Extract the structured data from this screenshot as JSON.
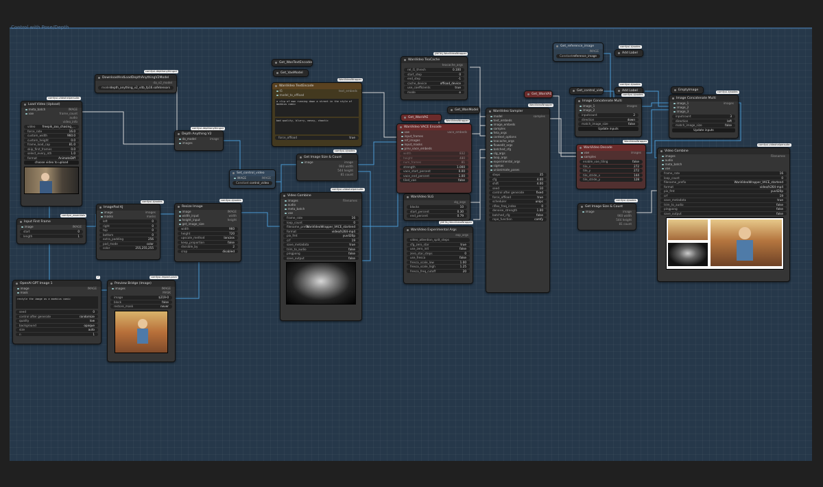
{
  "group": {
    "title": "Control with Pose/Depth"
  },
  "nodes": {
    "load_video": {
      "title": "Load Video (Upload)",
      "badge": "comfyui-videohelpersuite",
      "outputs": [
        "IMAGE",
        "frame_count",
        "audio",
        "video_info"
      ],
      "inputs": [
        "meta_batch",
        "vae"
      ],
      "widgets": [
        [
          "video",
          "freepik_zoo_chasing_..."
        ],
        [
          "force_rate",
          "16.0"
        ],
        [
          "custom_width",
          "960.0"
        ],
        [
          "custom_height",
          "0.0"
        ],
        [
          "frame_load_cap",
          "81.0"
        ],
        [
          "skip_first_frames",
          "0.0"
        ],
        [
          "select_every_nth",
          "1.0"
        ],
        [
          "format",
          "AnimateDiff"
        ]
      ],
      "button": "choose video to upload"
    },
    "download_depth": {
      "title": "DownloadAndLoadDepthAnythingV2Model",
      "badge": "comfyui-depthanythingv2",
      "output": "da_v2_model",
      "widgets": [
        [
          "model",
          "depth_anything_v2_vitb_fp16.safetensors"
        ]
      ]
    },
    "depth_anything": {
      "title": "Depth Anything V2",
      "badge": "comfyui-depthanythingv2",
      "inputs": [
        "da_model",
        "images"
      ],
      "output": "image"
    },
    "set_control": {
      "title": "Set_control_video",
      "in": "IMAGE",
      "out": "IMAGE",
      "widget_label": "Constant",
      "widget_value": "control_video"
    },
    "input_first_frame": {
      "title": "Input First Frame",
      "badge": "comfyui_essentials",
      "input": "image",
      "output": "IMAGE",
      "widgets": [
        [
          "start",
          "0"
        ],
        [
          "length",
          "1"
        ]
      ]
    },
    "image_pad": {
      "title": "ImagePad KJ",
      "badge": "comfyui-kjnodes",
      "inputs": [
        "image",
        "masks"
      ],
      "outputs": [
        "images",
        "masks"
      ],
      "widgets": [
        [
          "left",
          "0"
        ],
        [
          "right",
          "0"
        ],
        [
          "top",
          "0"
        ],
        [
          "bottom",
          "0"
        ],
        [
          "extra_padding",
          "256"
        ],
        [
          "pad_mode",
          "color"
        ],
        [
          "color",
          "255,255,255"
        ]
      ]
    },
    "resize_image": {
      "title": "Resize Image",
      "badge": "comfyui-kjnodes",
      "inputs": [
        "image",
        "width_input",
        "height_input",
        "get_image_size"
      ],
      "outputs": [
        "IMAGE",
        "width",
        "height"
      ],
      "widgets": [
        [
          "width",
          "960"
        ],
        [
          "height",
          "720"
        ],
        [
          "upscale_method",
          "lanczos"
        ],
        [
          "keep_proportion",
          "false"
        ],
        [
          "divisible_by",
          "2"
        ],
        [
          "crop",
          "disabled"
        ]
      ]
    },
    "openai": {
      "title": "OpenAI GPT Image 1",
      "badge": "?",
      "inputs": [
        "image",
        "mask"
      ],
      "output": "IMAGE",
      "prompt": "restyle the image as a moebius comic",
      "widgets": [
        [
          "seed",
          "0"
        ],
        [
          "control after generate",
          "randomize"
        ],
        [
          "quality",
          "low"
        ],
        [
          "background",
          "opaque"
        ],
        [
          "size",
          "auto"
        ],
        [
          "n",
          "1"
        ]
      ]
    },
    "preview_bridge": {
      "title": "Preview Bridge (Image)",
      "badge": "comfyui-impact-pack",
      "input": "images",
      "outputs": [
        "IMAGE",
        "MASK"
      ],
      "widgets": [
        [
          "image",
          "$219-0"
        ],
        [
          "block",
          "false"
        ],
        [
          "restore_mask",
          "never"
        ]
      ]
    },
    "get_vae_text": {
      "title": "Get_WanTextEncoder"
    },
    "get_vae_model": {
      "title": "Get_VaeModel"
    },
    "text_encode": {
      "title": "WanVideo TextEncode",
      "badge": "WanVideoWrapper",
      "inputs": [
        "t5",
        "model_to_offload"
      ],
      "output": "text_embeds",
      "positive": "a clip of man running down a street in the style of moebius comic",
      "negative": "bad quality, blurry, messy, chaotic",
      "widgets": [
        [
          "force_offload",
          "true"
        ]
      ]
    },
    "get_control": {
      "title": "Set_control_video"
    },
    "image_size": {
      "title": "Get Image Size & Count",
      "badge": "comfyui-kjnodes",
      "input": "image",
      "outputs": [
        [
          "image",
          ""
        ],
        [
          "width",
          "960"
        ],
        [
          "height",
          "544"
        ],
        [
          "count",
          "81"
        ]
      ]
    },
    "video_combine_1": {
      "title": "Video Combine",
      "badge": "comfyui-videohelpersuite",
      "inputs": [
        "images",
        "audio",
        "meta_batch",
        "vae"
      ],
      "output": "Filenames",
      "widgets": [
        [
          "frame_rate",
          "16"
        ],
        [
          "loop_count",
          "0"
        ],
        [
          "filename_prefix",
          "WanVideoWrapper_VACE_startend"
        ],
        [
          "format",
          "video/h264-mp4"
        ],
        [
          "pix_fmt",
          "yuv420p"
        ],
        [
          "crf",
          "19"
        ],
        [
          "save_metadata",
          "true"
        ],
        [
          "trim_to_audio",
          "false"
        ],
        [
          "pingpong",
          "false"
        ],
        [
          "save_output",
          "false"
        ]
      ]
    },
    "tea_cache": {
      "title": "WanVideo TeaCache",
      "output": "teacache_args",
      "widgets": [
        [
          "rel_l1_thresh",
          "0.100"
        ],
        [
          "start_step",
          "0"
        ],
        [
          "end_step",
          "-1"
        ],
        [
          "cache_device",
          "offload_device"
        ],
        [
          "use_coefficients",
          "true"
        ],
        [
          "mode",
          "e"
        ]
      ]
    },
    "get_wanvae": {
      "title": "Get_WanVAE"
    },
    "vace_encode": {
      "title": "WanVideo VACE Encode",
      "badge": "WanVideoWrapper",
      "inputs": [
        "vae",
        "input_frames",
        "ref_images",
        "input_masks",
        "prev_vace_embeds"
      ],
      "output": "vace_embeds",
      "widgets": [
        [
          "width",
          "832"
        ],
        [
          "height",
          "480"
        ],
        [
          "num_frames",
          "81"
        ],
        [
          "strength",
          "1.000"
        ],
        [
          "vace_start_percent",
          "0.00"
        ],
        [
          "vace_end_percent",
          "1.00"
        ],
        [
          "tiled_vae",
          "false"
        ]
      ]
    },
    "slg": {
      "title": "WanVideo SLG",
      "badge": "[BETA] WanVideoWrapper",
      "output": "slg_args",
      "widgets": [
        [
          "blocks",
          "10"
        ],
        [
          "start_percent",
          "0.30"
        ],
        [
          "end_percent",
          "0.79"
        ]
      ]
    },
    "exp_args": {
      "title": "WanVideo Experimental Args",
      "badge": "[BETA] WanVideoWrapper",
      "output": "exp_args",
      "widgets": [
        [
          "video_attention_split_steps",
          ""
        ],
        [
          "cfg_zero_star",
          "true"
        ],
        [
          "use_zero_init",
          "false"
        ],
        [
          "zero_star_steps",
          "0"
        ],
        [
          "use_fresca",
          "false"
        ],
        [
          "fresca_scale_low",
          "1.00"
        ],
        [
          "fresca_scale_high",
          "1.25"
        ],
        [
          "fresca_freq_cutoff",
          "20"
        ]
      ]
    },
    "get_wanmodel": {
      "title": "Get_WanModel"
    },
    "sampler": {
      "title": "WanVideo Sampler",
      "badge": "WanVideoWrapper",
      "output": "samples",
      "inputs": [
        "model",
        "text_embeds",
        "image_embeds",
        "samples",
        "feta_args",
        "context_options",
        "teacache_args",
        "flowedit_args",
        "batched_cfg",
        "slg_args",
        "loop_args",
        "experimental_args",
        "sigmas",
        "unianimate_poses"
      ],
      "widgets": [
        [
          "steps",
          "35"
        ],
        [
          "cfg",
          "4.00"
        ],
        [
          "shift",
          "4.00"
        ],
        [
          "seed",
          "10"
        ],
        [
          "control after generate",
          "fixed"
        ],
        [
          "force_offload",
          "true"
        ],
        [
          "scheduler",
          "unipc"
        ],
        [
          "riflex_freq_index",
          "0"
        ],
        [
          "denoise_strength",
          "1.00"
        ],
        [
          "batched_cfg",
          "false"
        ],
        [
          "rope_function",
          "comfy"
        ]
      ]
    },
    "get_ref": {
      "title": "Get_reference_image",
      "widget_label": "Constant",
      "widget_value": "reference_image"
    },
    "add_label": {
      "title": "Add Label",
      "badge": "comfyui-kjnodes"
    },
    "get_control2": {
      "title": "Get_control_video"
    },
    "add_label2": {
      "title": "Add Label",
      "badge": "comfyui-kjnodes"
    },
    "concat1": {
      "title": "Image Concatenate Multi",
      "badge": "comfyui-kjnodes",
      "inputs": [
        "image_1",
        "image_2"
      ],
      "output": "images",
      "widgets": [
        [
          "inputcount",
          "2"
        ],
        [
          "direction",
          "down"
        ],
        [
          "match_image_size",
          "false"
        ]
      ],
      "button": "Update inputs"
    },
    "empty_image": {
      "title": "EmptyImage"
    },
    "concat2": {
      "title": "Image Concatenate Multi",
      "badge": "comfyui-kjnodes",
      "inputs": [
        "image_1",
        "image_2",
        "image_3"
      ],
      "output": "images",
      "widgets": [
        [
          "inputcount",
          "3"
        ],
        [
          "direction",
          "left"
        ],
        [
          "match_image_size",
          "false"
        ]
      ],
      "button": "Update inputs"
    },
    "decode": {
      "title": "WanVideo Decode",
      "badge": "WanVideoWrapper",
      "inputs": [
        "vae",
        "samples"
      ],
      "output": "images",
      "widgets": [
        [
          "enable_vae_tiling",
          "false"
        ],
        [
          "tile_x",
          "272"
        ],
        [
          "tile_y",
          "272"
        ],
        [
          "tile_stride_x",
          "144"
        ],
        [
          "tile_stride_y",
          "128"
        ]
      ]
    },
    "image_size2": {
      "title": "Get Image Size & Count",
      "badge": "comfyui-kjnodes",
      "input": "image",
      "outputs": [
        [
          "image",
          ""
        ],
        [
          "width",
          "960"
        ],
        [
          "height",
          "544"
        ],
        [
          "count",
          "81"
        ]
      ]
    },
    "video_combine_2": {
      "title": "Video Combine",
      "badge": "comfyui-videohelpersuite",
      "inputs": [
        "images",
        "audio",
        "meta_batch",
        "vae"
      ],
      "output": "Filenames",
      "widgets": [
        [
          "frame_rate",
          "16"
        ],
        [
          "loop_count",
          "0"
        ],
        [
          "filename_prefix",
          "WanVideoWrapper_VACE_startend"
        ],
        [
          "format",
          "video/h264-mp4"
        ],
        [
          "pix_fmt",
          "yuv420p"
        ],
        [
          "crf",
          "19"
        ],
        [
          "save_metadata",
          "true"
        ],
        [
          "trim_to_audio",
          "false"
        ],
        [
          "pingpong",
          "false"
        ],
        [
          "save_output",
          "false"
        ]
      ]
    }
  },
  "colors": {
    "canvas": "#26384a",
    "node": "#353535",
    "vace": "#513030",
    "text_encode": "#43391f",
    "link_blue": "#4a9ad4",
    "link_white": "#d8d8d8"
  }
}
